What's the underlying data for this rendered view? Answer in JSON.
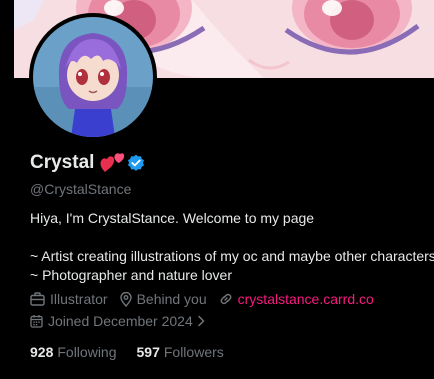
{
  "profile": {
    "display_name": "Crystal",
    "handle": "@CrystalStance",
    "bio_lines": [
      "Hiya, I'm CrystalStance. Welcome to my page",
      "~ Artist creating illustrations of my oc and maybe other characters",
      "~ Photographer and nature lover"
    ],
    "profession": "Illustrator",
    "location": "Behind you",
    "website": "crystalstance.carrd.co",
    "joined": "Joined December 2024"
  },
  "stats": {
    "following_count": "928",
    "following_label": "Following",
    "followers_count": "597",
    "followers_label": "Followers"
  },
  "icons": {
    "emoji": "two-hearts-icon",
    "verified": "verified-badge-icon",
    "profession": "briefcase-icon",
    "location": "location-pin-icon",
    "website": "link-icon",
    "joined": "calendar-icon",
    "expand": "chevron-right-icon"
  },
  "colors": {
    "background": "#000000",
    "text_primary": "#e7e9ea",
    "text_secondary": "#71767b",
    "link": "#f91880",
    "verified": "#1d9bf0",
    "banner_pink": "#f7dee3"
  }
}
